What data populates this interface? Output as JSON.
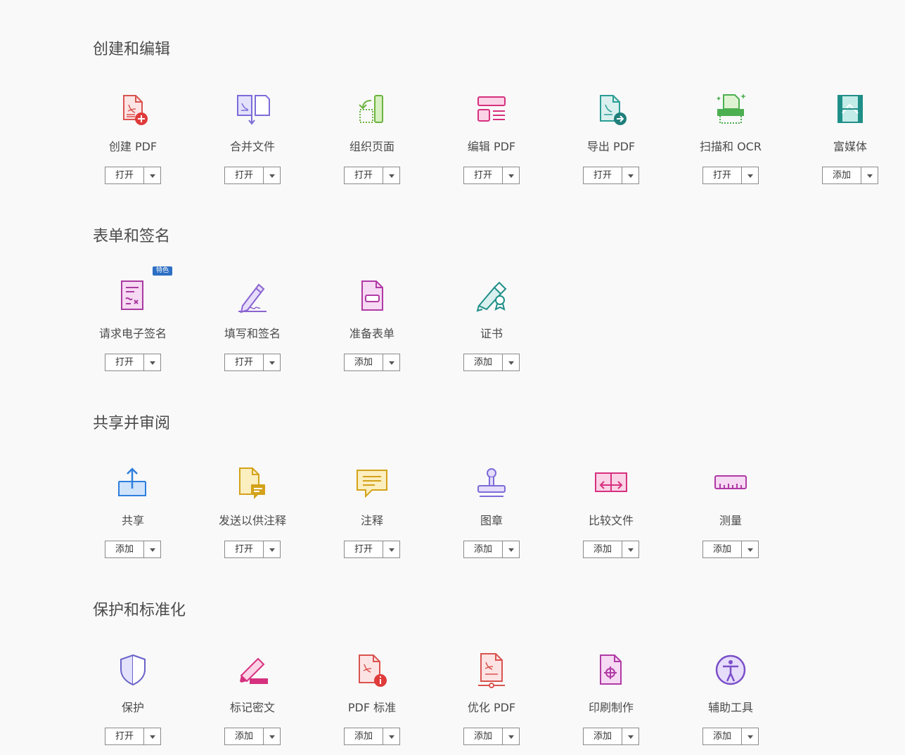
{
  "sections": [
    {
      "title": "创建和编辑",
      "tools": [
        {
          "label": "创建 PDF",
          "button": "打开",
          "icon": "create-pdf-icon"
        },
        {
          "label": "合并文件",
          "button": "打开",
          "icon": "combine-files-icon"
        },
        {
          "label": "组织页面",
          "button": "打开",
          "icon": "organize-pages-icon"
        },
        {
          "label": "编辑 PDF",
          "button": "打开",
          "icon": "edit-pdf-icon"
        },
        {
          "label": "导出 PDF",
          "button": "打开",
          "icon": "export-pdf-icon"
        },
        {
          "label": "扫描和 OCR",
          "button": "打开",
          "icon": "scan-ocr-icon"
        },
        {
          "label": "富媒体",
          "button": "添加",
          "icon": "rich-media-icon"
        }
      ]
    },
    {
      "title": "表单和签名",
      "tools": [
        {
          "label": "请求电子签名",
          "button": "打开",
          "icon": "request-esign-icon",
          "badge": "特色"
        },
        {
          "label": "填写和签名",
          "button": "打开",
          "icon": "fill-sign-icon"
        },
        {
          "label": "准备表单",
          "button": "添加",
          "icon": "prepare-form-icon"
        },
        {
          "label": "证书",
          "button": "添加",
          "icon": "certificate-icon"
        }
      ]
    },
    {
      "title": "共享并审阅",
      "tools": [
        {
          "label": "共享",
          "button": "添加",
          "icon": "share-icon"
        },
        {
          "label": "发送以供注释",
          "button": "打开",
          "icon": "send-for-comments-icon"
        },
        {
          "label": "注释",
          "button": "打开",
          "icon": "comment-icon"
        },
        {
          "label": "图章",
          "button": "添加",
          "icon": "stamp-icon"
        },
        {
          "label": "比较文件",
          "button": "添加",
          "icon": "compare-files-icon"
        },
        {
          "label": "测量",
          "button": "添加",
          "icon": "measure-icon"
        }
      ]
    },
    {
      "title": "保护和标准化",
      "tools": [
        {
          "label": "保护",
          "button": "打开",
          "icon": "protect-icon"
        },
        {
          "label": "标记密文",
          "button": "添加",
          "icon": "redact-icon"
        },
        {
          "label": "PDF 标准",
          "button": "添加",
          "icon": "pdf-standards-icon"
        },
        {
          "label": "优化 PDF",
          "button": "添加",
          "icon": "optimize-pdf-icon"
        },
        {
          "label": "印刷制作",
          "button": "添加",
          "icon": "print-production-icon"
        },
        {
          "label": "辅助工具",
          "button": "添加",
          "icon": "accessibility-icon"
        }
      ]
    }
  ],
  "colors": {
    "background": "#f9f9f9",
    "text": "#4b4b4b",
    "badge": "#2d6fc4"
  }
}
